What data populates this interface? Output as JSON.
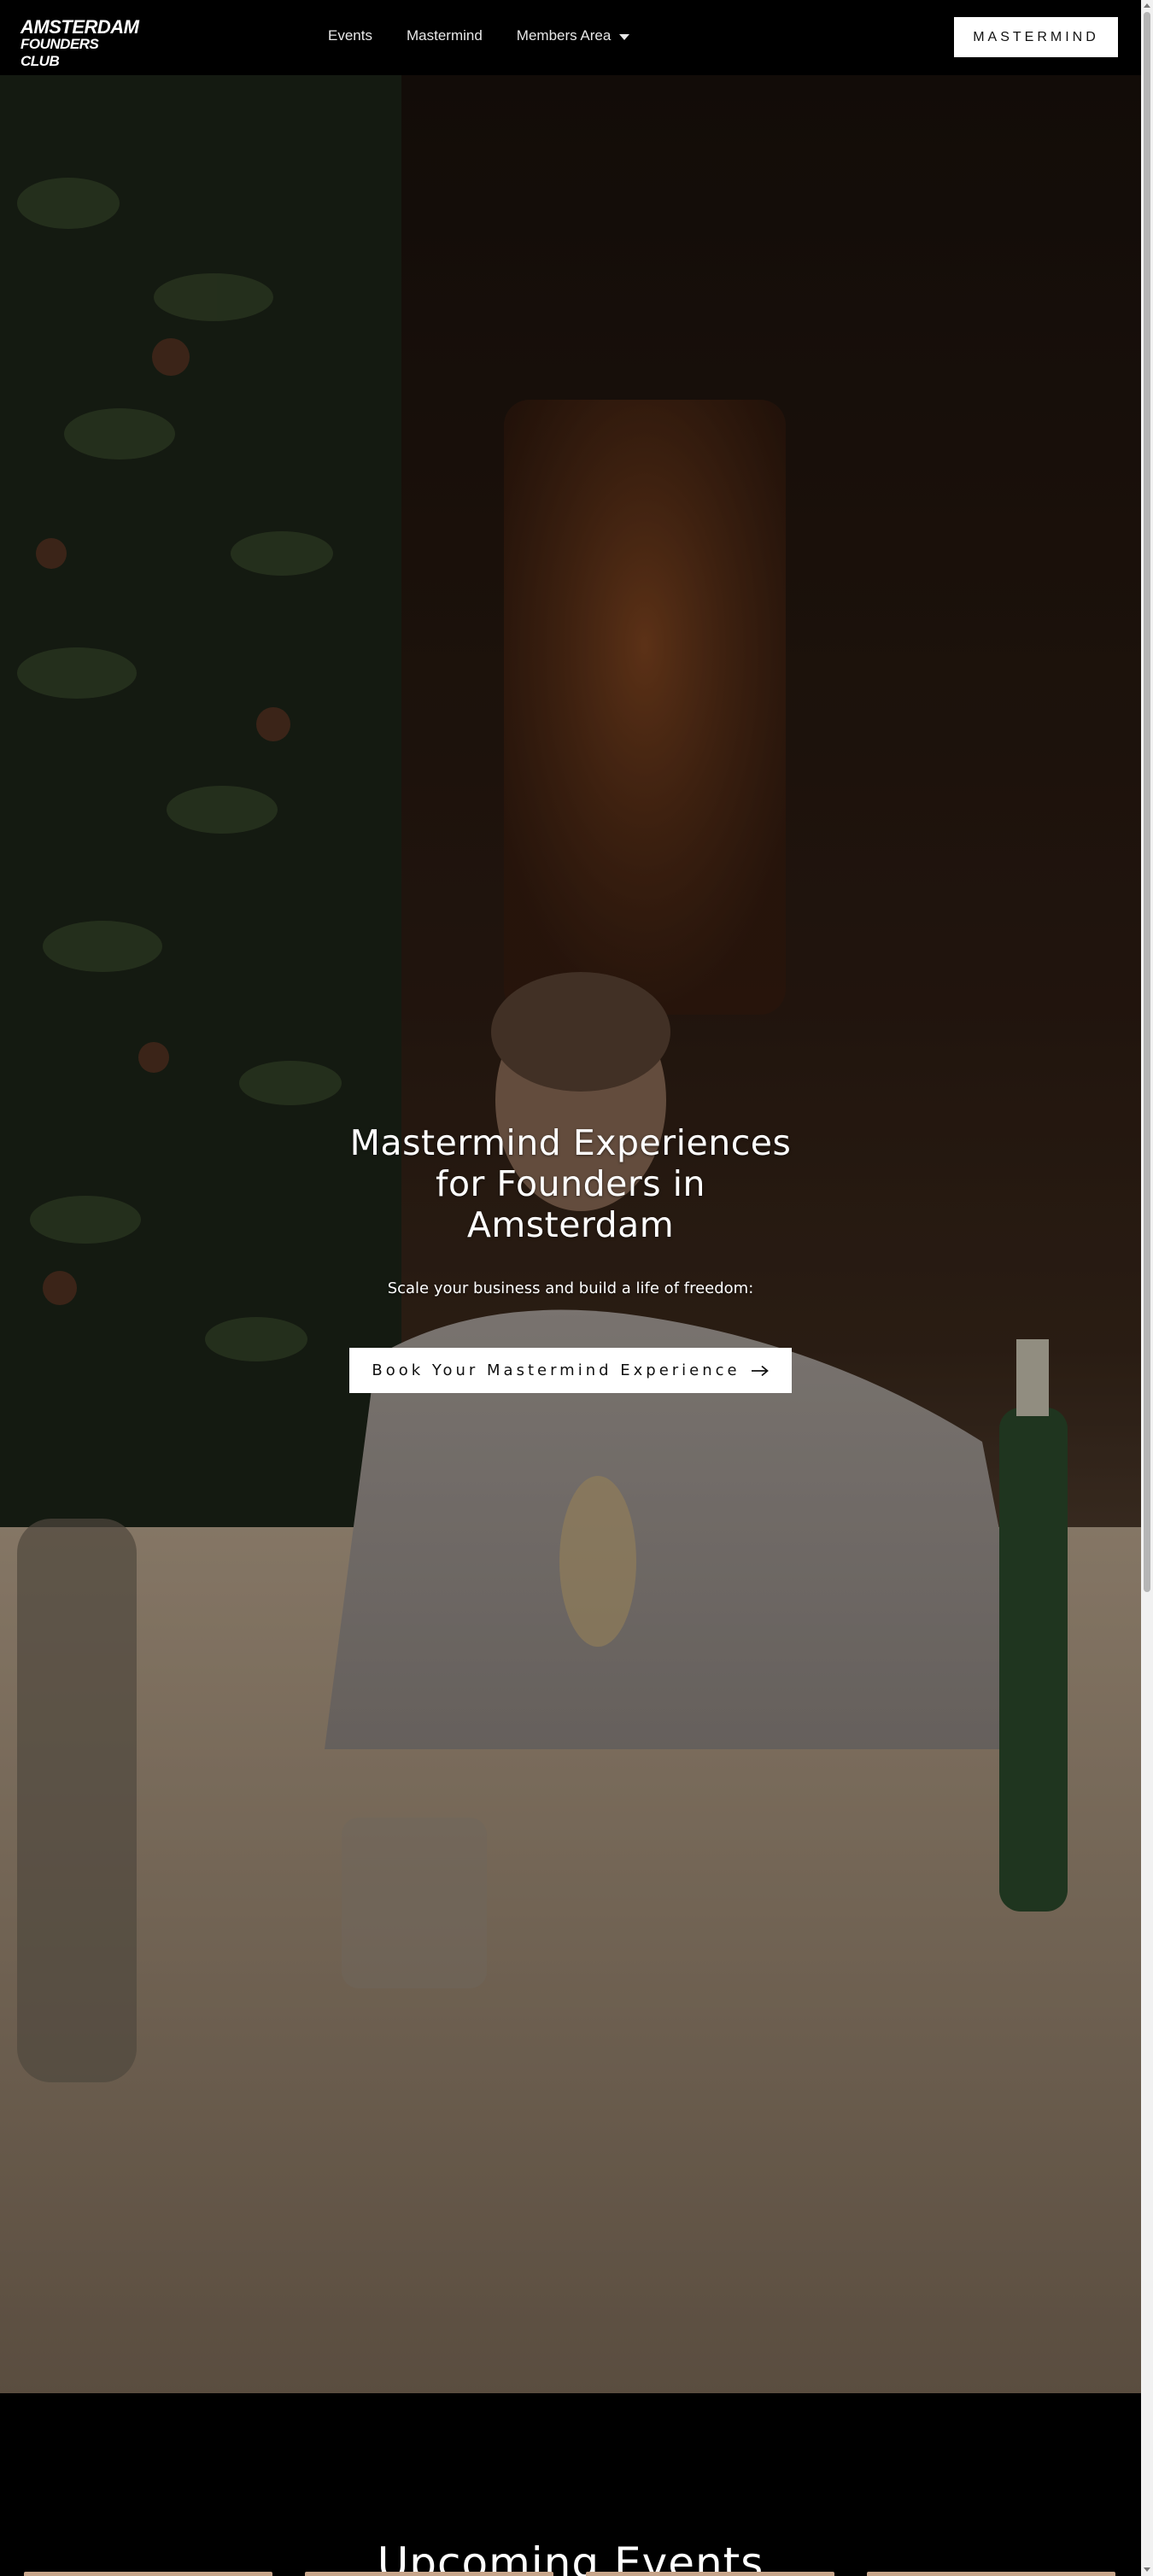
{
  "logo": {
    "line1": "AMSTERDAM",
    "line2": "FOUNDERS CLUB"
  },
  "nav": {
    "items": [
      {
        "label": "Events"
      },
      {
        "label": "Mastermind"
      },
      {
        "label": "Members Area",
        "has_dropdown": true
      }
    ],
    "cta_label": "MASTERMIND"
  },
  "hero": {
    "title": "Mastermind Experiences for Founders in Amsterdam",
    "subtitle": "Scale your business and build a life of freedom:",
    "cta_label": "Book Your Mastermind Experience",
    "cta_icon": "arrow-right-icon",
    "background": "photo of founders talking at a dinner table"
  },
  "events": {
    "title": "Upcoming Events"
  },
  "colors": {
    "header_bg": "#000000",
    "button_bg": "#ffffff",
    "button_text": "#111111",
    "text": "#ffffff"
  }
}
